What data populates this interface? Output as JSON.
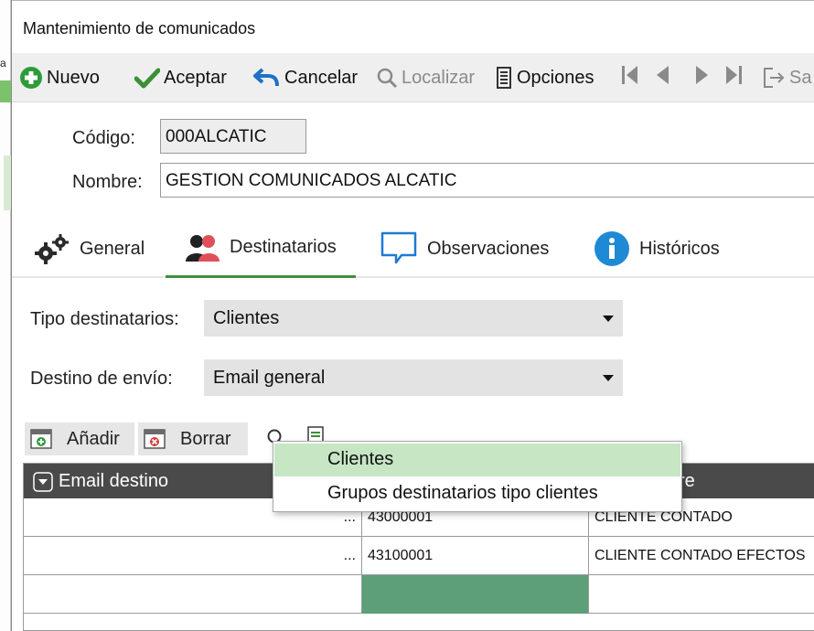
{
  "window": {
    "title": "Mantenimiento de comunicados"
  },
  "toolbar": {
    "nuevo": "Nuevo",
    "aceptar": "Aceptar",
    "cancelar": "Cancelar",
    "localizar": "Localizar",
    "opciones": "Opciones",
    "salir": "Sa"
  },
  "form": {
    "codigo_label": "Código:",
    "codigo_value": "000ALCATIC",
    "nombre_label": "Nombre:",
    "nombre_value": "GESTION COMUNICADOS ALCATIC"
  },
  "tabs": [
    {
      "label": "General",
      "icon": "gears-icon"
    },
    {
      "label": "Destinatarios",
      "icon": "users-icon"
    },
    {
      "label": "Observaciones",
      "icon": "speech-bubble-icon"
    },
    {
      "label": "Históricos",
      "icon": "info-icon"
    }
  ],
  "destinatarios": {
    "tipo_label": "Tipo destinatarios:",
    "tipo_value": "Clientes",
    "destino_label": "Destino de envío:",
    "destino_value": "Email general",
    "anadir": "Añadir",
    "borrar": "Borrar"
  },
  "grid": {
    "col_email": "Email destino",
    "col_name_partial": "re",
    "rows": [
      {
        "dots": "...",
        "code": "43000001",
        "name": "CLIENTE CONTADO"
      },
      {
        "dots": "...",
        "code": "43100001",
        "name": "CLIENTE CONTADO EFECTOS"
      },
      {
        "dots": "",
        "code": "",
        "name": ""
      }
    ]
  },
  "dropdown": {
    "options": [
      "Clientes",
      "Grupos destinatarios tipo clientes"
    ],
    "selected": "Clientes"
  },
  "colors": {
    "accent_green": "#3f8f3f",
    "highlight_green": "#c6e6c4",
    "active_cell": "#5c9f78",
    "header_dark": "#4a4a4a"
  }
}
